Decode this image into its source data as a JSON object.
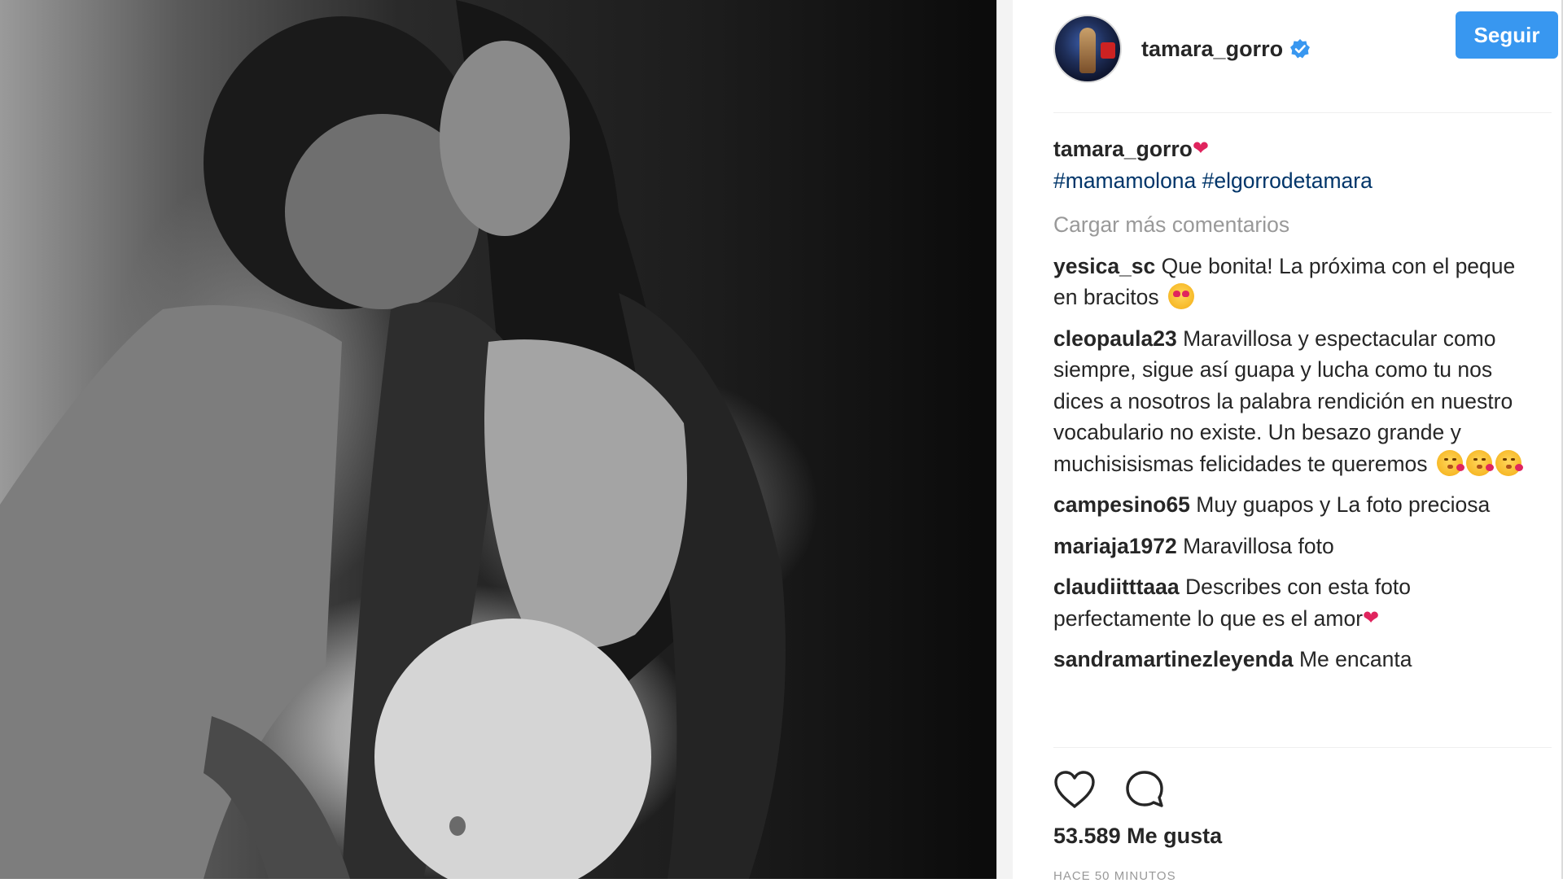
{
  "post": {
    "username": "tamara_gorro",
    "follow_label": "Seguir",
    "caption_user": "tamara_gorro",
    "caption_tags": "#mamamolona #elgorrodetamara",
    "load_more": "Cargar más comentarios",
    "likes": "53.589 Me gusta",
    "time": "HACE 50 MINUTOS"
  },
  "comments": [
    {
      "user": "yesica_sc",
      "text": "Que bonita! La próxima con el peque en bracitos",
      "emoji": "heart-eyes"
    },
    {
      "user": "cleopaula23",
      "text": "Maravillosa y espectacular como siempre, sigue así guapa y lucha como tu nos dices a nosotros la palabra rendición en nuestro vocabulario no existe. Un besazo grande y muchisisismas felicidades te queremos",
      "emoji": "kiss"
    },
    {
      "user": "campesino65",
      "text": "Muy guapos y La foto preciosa"
    },
    {
      "user": "mariaja1972",
      "text": "Maravillosa foto"
    },
    {
      "user": "claudiitttaaa",
      "text": "Describes con esta foto perfectamente lo que es el amor"
    },
    {
      "user": "sandramartinezleyenda",
      "text": "Me encanta"
    }
  ],
  "icons": [
    "verified-badge-icon",
    "heart-icon",
    "comment-icon"
  ],
  "colors": {
    "accent": "#3897f0",
    "hashtag": "#003569",
    "muted": "#999999",
    "heart": "#e0245e"
  }
}
